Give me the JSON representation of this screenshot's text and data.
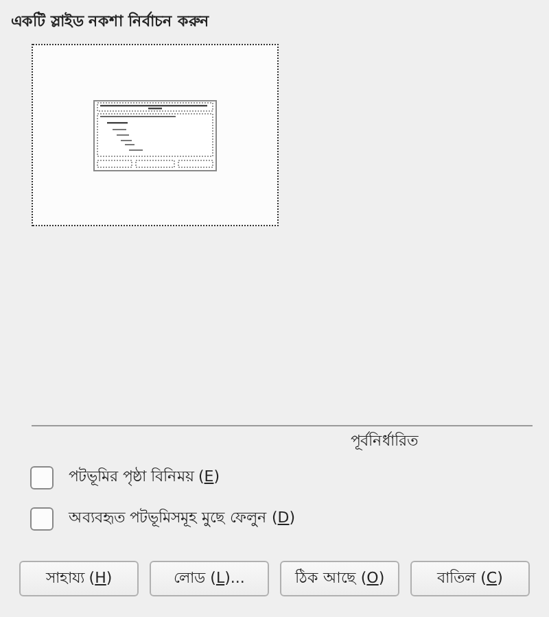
{
  "title": "একটি স্লাইড নকশা নির্বাচন করুন",
  "section_label": "পূর্বনির্ধারিত",
  "options": [
    {
      "before": "পটভূমির পৃষ্ঠা বিনিময় (",
      "key": "E",
      "after": ")",
      "checked": false
    },
    {
      "before": "অব্যবহৃত পটভূমিসমূহ মুছে ফেলুন (",
      "key": "D",
      "after": ")",
      "checked": false
    }
  ],
  "buttons": [
    {
      "before": "সাহায্য (",
      "key": "H",
      "after": ")"
    },
    {
      "before": "লোড (",
      "key": "L",
      "after": ")..."
    },
    {
      "before": "ঠিক আছে (",
      "key": "O",
      "after": ")"
    },
    {
      "before": "বাতিল (",
      "key": "C",
      "after": ")"
    }
  ]
}
